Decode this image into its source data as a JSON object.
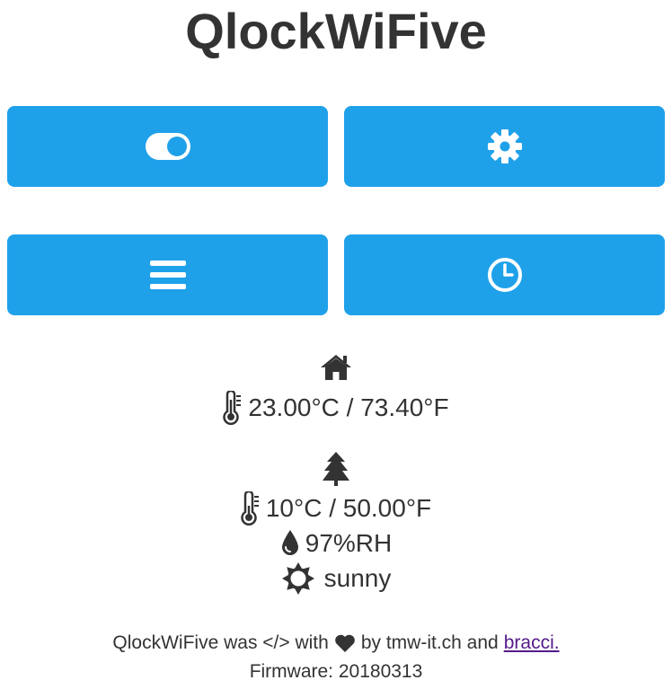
{
  "app": {
    "title": "QlockWiFive"
  },
  "buttons": [
    {
      "name": "power-toggle",
      "icon": "toggle-on-icon"
    },
    {
      "name": "settings",
      "icon": "gear-icon"
    },
    {
      "name": "menu",
      "icon": "bars-icon"
    },
    {
      "name": "clock",
      "icon": "clock-icon"
    }
  ],
  "colors": {
    "accent": "#1fa1ea",
    "text": "#333333",
    "link": "#551a8b"
  },
  "indoor": {
    "icon": "home-icon",
    "temperature": "23.00°C / 73.40°F"
  },
  "outdoor": {
    "icon": "tree-icon",
    "temperature": "10°C / 50.00°F",
    "humidity": "97%RH",
    "weather": "sunny",
    "weather_icon": "sun-icon"
  },
  "footer": {
    "credits_prefix": "QlockWiFive was </> with",
    "credits_suffix": "by tmw-it.ch and",
    "credits_link": "bracci.",
    "firmware": "Firmware: 20180313"
  }
}
